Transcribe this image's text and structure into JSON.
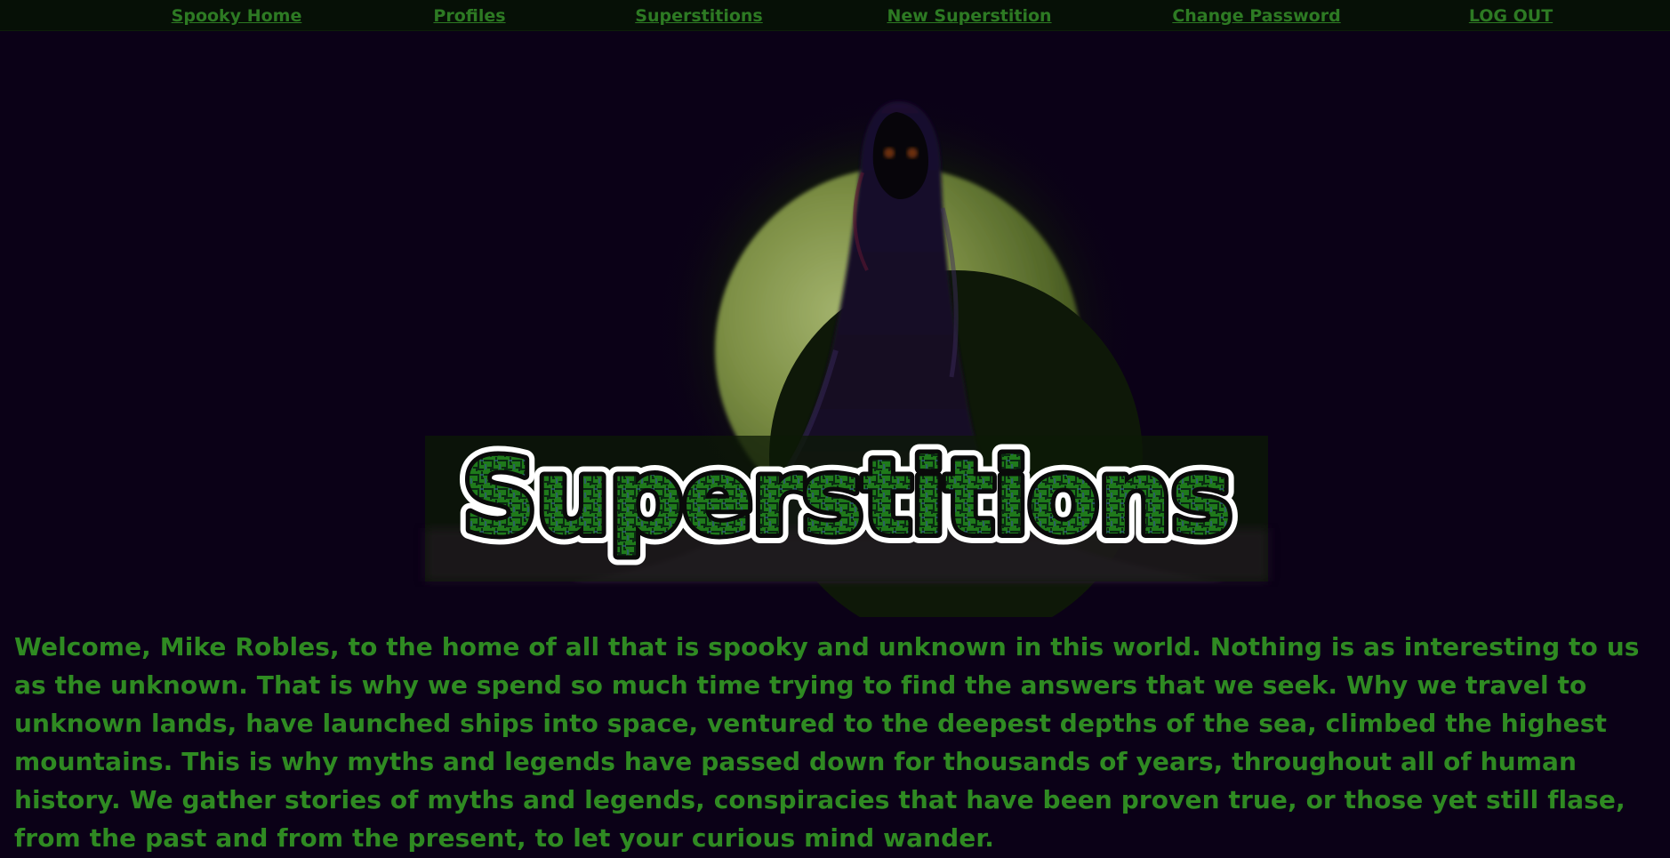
{
  "nav": {
    "items": [
      {
        "label": "Spooky Home"
      },
      {
        "label": "Profiles"
      },
      {
        "label": "Superstitions"
      },
      {
        "label": "New Superstition"
      },
      {
        "label": "Change Password"
      },
      {
        "label": "LOG OUT"
      }
    ]
  },
  "hero": {
    "logo_text": "Superstitions"
  },
  "welcome": {
    "text": "Welcome, Mike Robles, to the home of all that is spooky and unknown in this world. Nothing is as interesting to us as the unknown. That is why we spend so much time trying to find the answers that we seek. Why we travel to unknown lands, have launched ships into space, ventured to the deepest depths of the sea, climbed the highest mountains. This is why myths and legends have passed down for thousands of years, throughout all of human history. We gather stories of myths and legends, conspiracies that have been proven true, or those yet still flase, from the past and from the present, to let your curious mind wander."
  },
  "colors": {
    "background": "#0b0117",
    "nav_background": "#061006",
    "link": "#2d7a23",
    "text": "#2f8a22"
  }
}
